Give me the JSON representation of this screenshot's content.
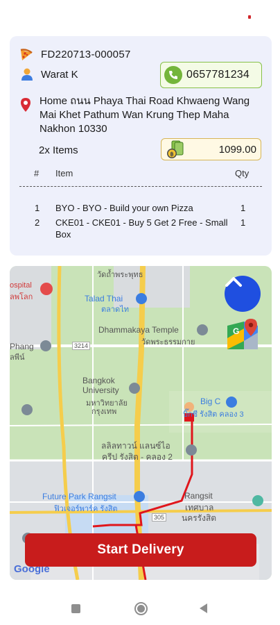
{
  "order": {
    "number": "FD220713-000057",
    "customer_name": "Warat K",
    "phone": "0657781234",
    "address": "Home  ถนน Phaya Thai Road  Khwaeng Wang Mai  Khet Pathum Wan  Krung Thep Maha Nakhon  10330",
    "items_count": "2x Items",
    "total": "1099.00"
  },
  "table": {
    "headers": {
      "num": "#",
      "item": "Item",
      "qty": "Qty"
    },
    "rows": [
      {
        "num": "1",
        "item": "BYO - BYO - Build your own Pizza",
        "qty": "1"
      },
      {
        "num": "2",
        "item": "CKE01 - CKE01 - Buy 5 Get 2 Free - Small Box",
        "qty": "1"
      }
    ]
  },
  "map": {
    "labels": {
      "hospital": "ospital",
      "hospital_th": "ลพโลก",
      "talad_thai": "Talad Thai",
      "talad_thai_th": "ตลาดไท",
      "temple": "Dhammakaya Temple",
      "temple_th": "วัดพระธรรมกาย",
      "phang": "Phang",
      "phang_th": "ลพีน์",
      "road_3214": "3214",
      "bku": "Bangkok University",
      "bku_th1": "มหาวิทยาลัย",
      "bku_th2": "กรุงเทพ",
      "bigc": "Big C",
      "bigc_th": "บิ๊กซี รังสิต คลอง 3",
      "lalit": "ลลิลทาวน์ แลนซ์ไอ",
      "lalit2": "ครีป รังสิต - คลอง 2",
      "future_park": "Future Park Rangsit",
      "future_park_th": "ฟิวเจอร์พาร์ค รังสิต",
      "rangsit": "Rangsit",
      "rangsit_th1": "เทศบาล",
      "rangsit_th2": "นครรังสิต",
      "road_305": "305",
      "top_label": "วัดถ้ำพระพุทธ"
    },
    "google": "Google"
  },
  "actions": {
    "start_delivery": "Start Delivery"
  },
  "colors": {
    "accent_red": "#c81c1c",
    "phone_green": "#74b53b",
    "map_button_blue": "#1f4fe0",
    "card_bg": "#eef0fb"
  },
  "icons": {
    "order": "pizza-icon",
    "customer": "person-icon",
    "phone": "phone-icon",
    "address": "location-pin-icon",
    "total": "money-icon",
    "collapse": "chevron-up-icon",
    "navigate": "google-maps-icon"
  }
}
